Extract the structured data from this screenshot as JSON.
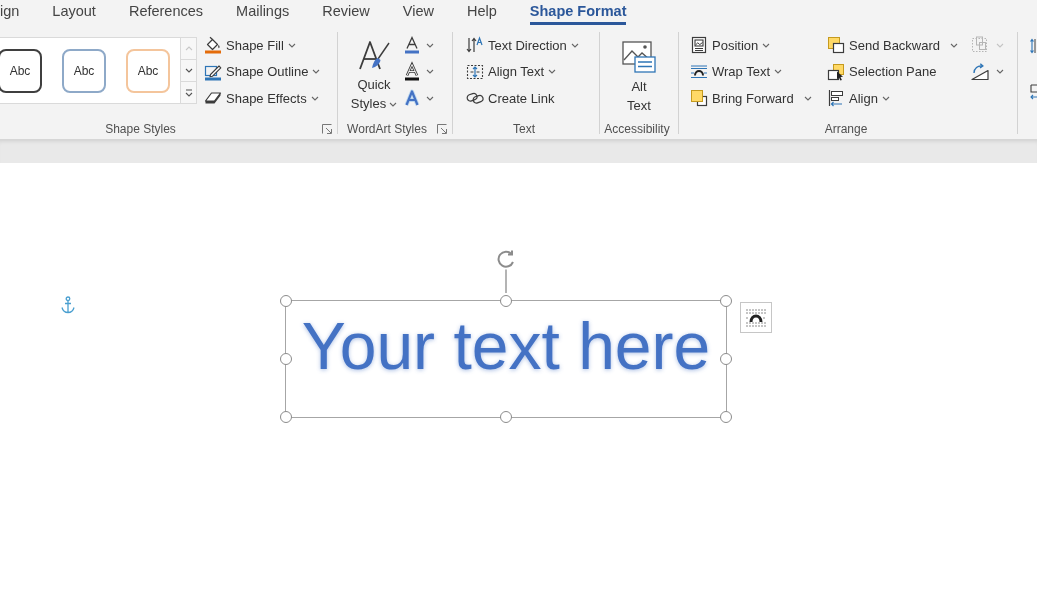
{
  "tabs": [
    {
      "label": "ign",
      "selected": false
    },
    {
      "label": "Layout",
      "selected": false
    },
    {
      "label": "References",
      "selected": false
    },
    {
      "label": "Mailings",
      "selected": false
    },
    {
      "label": "Review",
      "selected": false
    },
    {
      "label": "View",
      "selected": false
    },
    {
      "label": "Help",
      "selected": false
    },
    {
      "label": "Shape Format",
      "selected": true
    }
  ],
  "ribbon": {
    "shape_styles": {
      "label": "Shape Styles",
      "launcher": true,
      "gallery": [
        {
          "label": "Abc",
          "color": "#3f3f3f"
        },
        {
          "label": "Abc",
          "color": "#8ea9c8"
        },
        {
          "label": "Abc",
          "color": "#f4c59c"
        }
      ],
      "gallery_scroll": [
        {
          "kind": "up",
          "disabled": true
        },
        {
          "kind": "down",
          "disabled": false
        },
        {
          "kind": "more",
          "disabled": false
        }
      ],
      "commands": [
        {
          "label": "Shape Fill",
          "kind": "menu"
        },
        {
          "label": "Shape Outline",
          "kind": "menu"
        },
        {
          "label": "Shape Effects",
          "kind": "menu"
        }
      ]
    },
    "wordart_styles": {
      "label": "WordArt Styles",
      "launcher": true,
      "quick_styles": {
        "label": "Quick Styles",
        "kind": "menu"
      }
    },
    "text": {
      "label": "Text",
      "commands": [
        {
          "label": "Text Direction",
          "kind": "menu"
        },
        {
          "label": "Align Text",
          "kind": "menu"
        },
        {
          "label": "Create Link",
          "kind": "plain"
        }
      ]
    },
    "accessibility": {
      "label": "Accessibility",
      "alt_text": {
        "label": "Alt Text"
      }
    },
    "arrange": {
      "label": "Arrange",
      "commands": [
        {
          "label": "Position",
          "kind": "menu"
        },
        {
          "label": "Wrap Text",
          "kind": "menu"
        },
        {
          "label": "Bring Forward",
          "kind": "split"
        },
        {
          "label": "Send Backward",
          "kind": "split"
        },
        {
          "label": "Selection Pane",
          "kind": "plain"
        },
        {
          "label": "Align",
          "kind": "menu"
        }
      ],
      "icon_buttons": [
        {
          "disabled": true
        },
        {
          "disabled": false
        }
      ]
    }
  },
  "document": {
    "text_box": {
      "text": "Your text here",
      "selected": true
    }
  }
}
